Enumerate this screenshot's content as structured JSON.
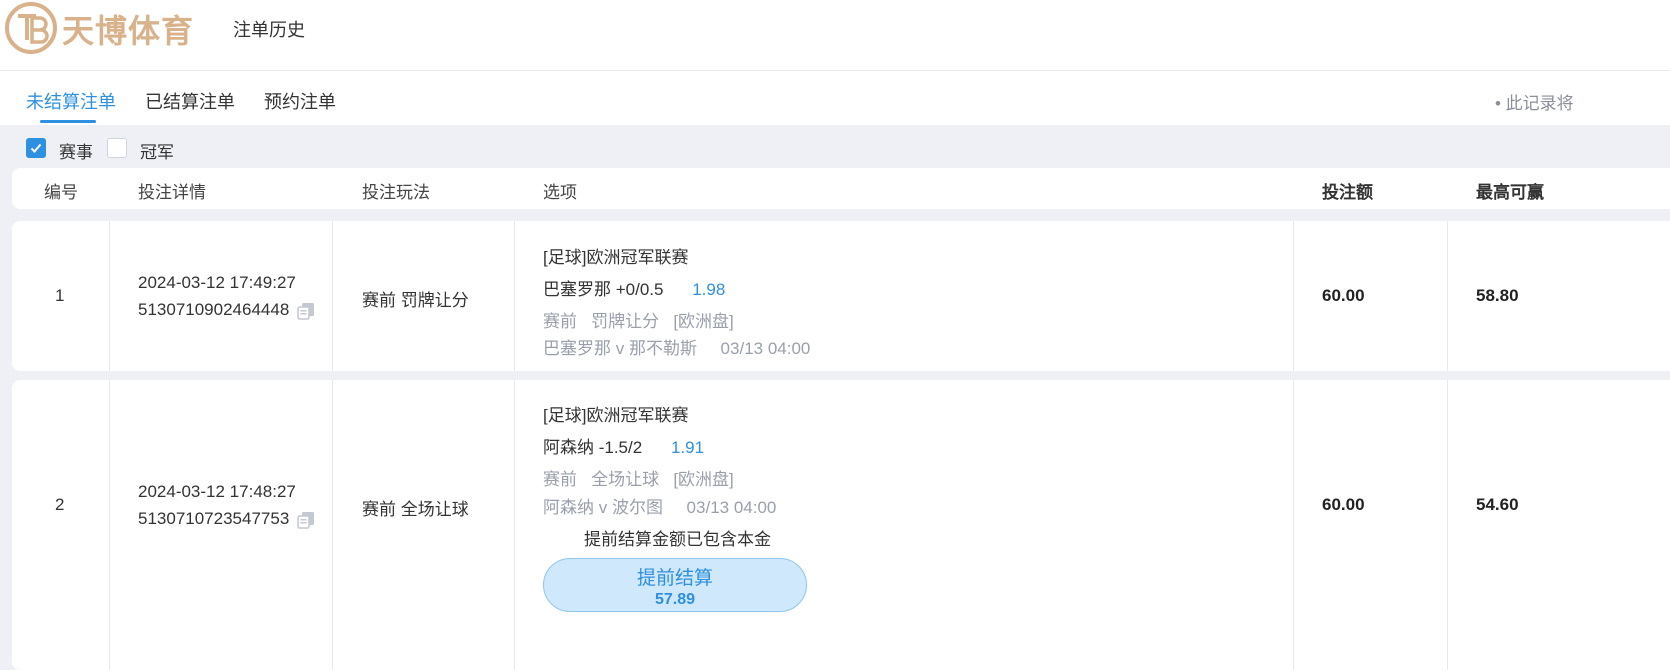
{
  "header": {
    "logo_text": "天博体育",
    "logo_monogram": "TB",
    "title": "注单历史"
  },
  "tabs": [
    {
      "label": "未结算注单",
      "active": true
    },
    {
      "label": "已结算注单",
      "active": false
    },
    {
      "label": "预约注单",
      "active": false
    }
  ],
  "tab_note": "• 此记录将",
  "filters": [
    {
      "label": "赛事",
      "checked": true
    },
    {
      "label": "冠军",
      "checked": false
    }
  ],
  "table": {
    "headers": {
      "id": "编号",
      "details": "投注详情",
      "play": "投注玩法",
      "option": "选项",
      "stake": "投注额",
      "max_win": "最高可赢"
    },
    "rows": [
      {
        "id": "1",
        "datetime": "2024-03-12 17:49:27",
        "bet_no": "5130710902464448",
        "play": "赛前 罚牌让分",
        "league": "[足球]欧洲冠军联赛",
        "selection": "巴塞罗那 +0/0.5",
        "odds": "1.98",
        "market": "赛前   罚牌让分   [欧洲盘]",
        "match": "巴塞罗那 v 那不勒斯     03/13 04:00",
        "stake": "60.00",
        "max_win": "58.80"
      },
      {
        "id": "2",
        "datetime": "2024-03-12 17:48:27",
        "bet_no": "5130710723547753",
        "play": "赛前 全场让球",
        "league": "[足球]欧洲冠军联赛",
        "selection": "阿森纳 -1.5/2",
        "odds": "1.91",
        "market": "赛前   全场让球   [欧洲盘]",
        "match": "阿森纳 v 波尔图     03/13 04:00",
        "cashout_note": "提前结算金额已包含本金",
        "cashout_label": "提前结算",
        "cashout_amount": "57.89",
        "stake": "60.00",
        "max_win": "54.60"
      }
    ]
  },
  "colors": {
    "accent": "#2e90e0",
    "logo_gold": "#d9b28c",
    "background_grey": "#eef0f5",
    "muted_text": "#9aa0ab",
    "cashout_bg": "#cfe8fb"
  }
}
